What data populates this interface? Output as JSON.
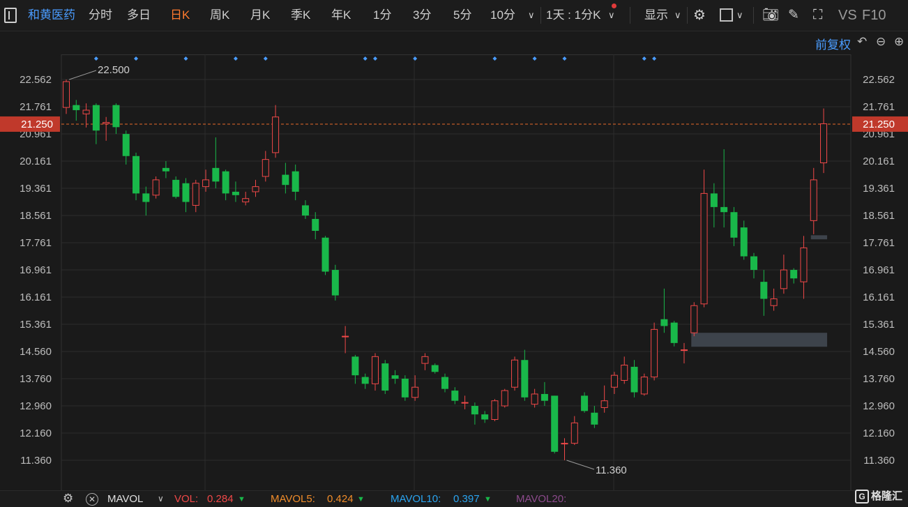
{
  "toolbar": {
    "menu_icon": "sidebar-toggle-icon",
    "stock_name": "和黄医药",
    "periods": [
      "分时",
      "多日",
      "日K",
      "周K",
      "月K",
      "季K",
      "年K",
      "1分",
      "3分",
      "5分",
      "10分"
    ],
    "active_period": "日K",
    "interval_label": "1天 : 1分K",
    "display_label": "显示",
    "vs_label": "VS",
    "f10_label": "F10"
  },
  "sub": {
    "adjust_label": "前复权"
  },
  "chart_data": {
    "type": "candlestick",
    "y_ticks": [
      "22.562",
      "21.761",
      "20.961",
      "20.161",
      "19.361",
      "18.561",
      "17.761",
      "16.961",
      "16.161",
      "15.361",
      "14.560",
      "13.760",
      "12.960",
      "12.160",
      "11.360"
    ],
    "current_price": "21.250",
    "high_label": "22.500",
    "low_label": "11.360",
    "colors": {
      "up": "#f04848",
      "down": "#19b84a",
      "price_line": "#e86a2a",
      "grid": "#2c2c2c",
      "marker": "#4a9cff"
    },
    "candles": [
      [
        21.74,
        22.5,
        22.56,
        21.55
      ],
      [
        21.81,
        21.66,
        21.96,
        21.35
      ],
      [
        21.55,
        21.66,
        21.86,
        21.15
      ],
      [
        21.81,
        21.06,
        21.86,
        20.66
      ],
      [
        21.26,
        21.3,
        21.46,
        20.76
      ],
      [
        21.81,
        21.16,
        21.86,
        20.96
      ],
      [
        20.96,
        20.31,
        21.06,
        20.06
      ],
      [
        20.31,
        19.21,
        20.41,
        19.01
      ],
      [
        19.21,
        18.96,
        19.41,
        18.56
      ],
      [
        19.16,
        19.61,
        19.71,
        19.06
      ],
      [
        19.96,
        19.86,
        20.16,
        19.66
      ],
      [
        19.61,
        19.11,
        19.71,
        19.06
      ],
      [
        19.51,
        18.96,
        19.66,
        18.66
      ],
      [
        18.86,
        19.51,
        19.61,
        18.66
      ],
      [
        19.41,
        19.61,
        19.91,
        19.26
      ],
      [
        19.96,
        19.56,
        20.86,
        19.36
      ],
      [
        19.86,
        19.21,
        19.91,
        19.01
      ],
      [
        19.26,
        19.16,
        19.56,
        18.96
      ],
      [
        18.96,
        19.06,
        19.26,
        18.86
      ],
      [
        19.26,
        19.41,
        19.61,
        19.11
      ],
      [
        19.71,
        20.21,
        20.46,
        19.56
      ],
      [
        20.41,
        21.46,
        21.81,
        20.26
      ],
      [
        19.76,
        19.46,
        20.11,
        19.21
      ],
      [
        19.86,
        19.26,
        20.06,
        19.01
      ],
      [
        18.86,
        18.56,
        19.01,
        18.46
      ],
      [
        18.46,
        18.11,
        18.66,
        17.86
      ],
      [
        17.91,
        16.91,
        17.96,
        16.81
      ],
      [
        16.96,
        16.21,
        17.11,
        16.06
      ],
      [
        15.01,
        15.01,
        15.31,
        14.51
      ],
      [
        14.41,
        13.86,
        14.46,
        13.61
      ],
      [
        13.81,
        13.61,
        13.91,
        13.46
      ],
      [
        13.61,
        14.41,
        14.51,
        13.41
      ],
      [
        14.21,
        13.41,
        14.31,
        13.31
      ],
      [
        13.86,
        13.76,
        14.01,
        13.61
      ],
      [
        13.76,
        13.21,
        13.86,
        13.11
      ],
      [
        13.21,
        13.51,
        13.86,
        13.11
      ],
      [
        14.21,
        14.41,
        14.51,
        14.01
      ],
      [
        14.16,
        13.96,
        14.21,
        13.91
      ],
      [
        13.81,
        13.46,
        13.91,
        13.36
      ],
      [
        13.41,
        13.11,
        13.51,
        13.01
      ],
      [
        13.06,
        13.06,
        13.26,
        12.86
      ],
      [
        12.96,
        12.71,
        13.06,
        12.41
      ],
      [
        12.71,
        12.56,
        12.81,
        12.46
      ],
      [
        12.56,
        13.11,
        13.16,
        12.51
      ],
      [
        12.96,
        13.41,
        13.46,
        12.91
      ],
      [
        13.51,
        14.31,
        14.41,
        13.41
      ],
      [
        14.31,
        13.21,
        14.61,
        13.11
      ],
      [
        13.01,
        13.31,
        13.46,
        12.91
      ],
      [
        13.31,
        13.11,
        13.66,
        12.96
      ],
      [
        13.26,
        11.61,
        13.26,
        11.56
      ],
      [
        11.86,
        11.86,
        12.01,
        11.36
      ],
      [
        11.86,
        12.46,
        12.66,
        11.81
      ],
      [
        13.26,
        12.81,
        13.36,
        12.76
      ],
      [
        12.76,
        12.41,
        12.96,
        12.31
      ],
      [
        12.91,
        13.11,
        13.56,
        12.76
      ],
      [
        13.51,
        13.86,
        13.96,
        13.31
      ],
      [
        13.71,
        14.16,
        14.41,
        13.61
      ],
      [
        14.11,
        13.36,
        14.31,
        13.21
      ],
      [
        13.31,
        13.81,
        13.91,
        13.26
      ],
      [
        13.81,
        15.21,
        15.41,
        13.71
      ],
      [
        15.51,
        15.31,
        16.41,
        15.11
      ],
      [
        15.41,
        14.81,
        15.46,
        14.71
      ],
      [
        14.61,
        14.61,
        14.81,
        14.21
      ],
      [
        15.11,
        15.91,
        16.01,
        15.01
      ],
      [
        15.96,
        19.21,
        19.91,
        15.86
      ],
      [
        19.21,
        18.81,
        19.51,
        18.21
      ],
      [
        18.81,
        18.66,
        20.51,
        18.21
      ],
      [
        18.66,
        17.91,
        18.81,
        17.66
      ],
      [
        18.21,
        17.36,
        18.41,
        17.26
      ],
      [
        17.36,
        16.96,
        17.46,
        16.71
      ],
      [
        16.61,
        16.11,
        16.96,
        15.61
      ],
      [
        15.91,
        16.11,
        16.41,
        15.76
      ],
      [
        16.41,
        16.96,
        17.41,
        16.26
      ],
      [
        16.96,
        16.71,
        17.01,
        16.56
      ],
      [
        16.61,
        17.61,
        17.96,
        16.11
      ],
      [
        18.41,
        19.61,
        19.96,
        18.01
      ],
      [
        20.11,
        21.26,
        21.71,
        19.81
      ]
    ],
    "event_marker_candles": [
      3,
      7,
      12,
      17,
      20,
      30,
      31,
      35,
      43,
      47,
      50,
      58,
      59
    ],
    "gap_zones": [
      {
        "from_candle": 63,
        "to_candle": 76,
        "low": 14.7,
        "high": 15.11
      },
      {
        "from_candle": 75,
        "to_candle": 76,
        "low": 17.86,
        "high": 17.98
      }
    ]
  },
  "volume": {
    "label": "MAVOL",
    "vol": {
      "name": "VOL:",
      "value": "0.284",
      "color": "#f04848"
    },
    "ma5": {
      "name": "MAVOL5:",
      "value": "0.424",
      "color": "#f08c2a"
    },
    "ma10": {
      "name": "MAVOL10:",
      "value": "0.397",
      "color": "#2aa4f0"
    },
    "ma20": {
      "name": "MAVOL20:",
      "value": "",
      "color": "#8c4a8c"
    }
  },
  "logo": {
    "text": "格隆汇",
    "mark": "G"
  }
}
